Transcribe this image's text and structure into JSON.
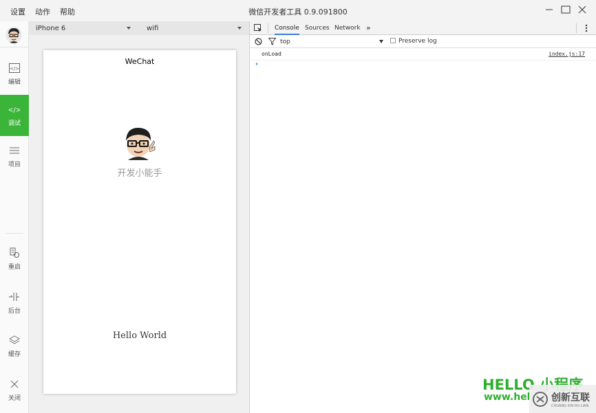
{
  "window": {
    "menu": [
      "设置",
      "动作",
      "帮助"
    ],
    "title": "微信开发者工具 0.9.091800"
  },
  "sidebar": {
    "items": [
      {
        "label": "编辑",
        "icon": "code-file-icon"
      },
      {
        "label": "调试",
        "icon": "code-brackets-icon",
        "active": true
      },
      {
        "label": "项目",
        "icon": "menu-lines-icon"
      },
      {
        "label": "重启",
        "icon": "restart-icon"
      },
      {
        "label": "后台",
        "icon": "background-icon"
      },
      {
        "label": "缓存",
        "icon": "layers-icon"
      },
      {
        "label": "关闭",
        "icon": "close-icon"
      }
    ]
  },
  "simulator": {
    "device": "iPhone 6",
    "network": "wifi",
    "page_title": "WeChat",
    "nickname": "开发小能手",
    "hello": "Hello World"
  },
  "devtools": {
    "tabs": [
      "Console",
      "Sources",
      "Network"
    ],
    "more": "»",
    "context": "top",
    "preserve_log": "Preserve log",
    "logs": [
      {
        "text": "onLoad",
        "source": "index.js:17"
      }
    ],
    "prompt": "›"
  },
  "watermark": {
    "line1": "HELLO 小程序",
    "line2": "www.hel",
    "badge": "创新互联",
    "badge_sub": "CHUANG XIN HU LIAN"
  },
  "colors": {
    "accent": "#3ab539",
    "link": "#3a7bd5"
  }
}
